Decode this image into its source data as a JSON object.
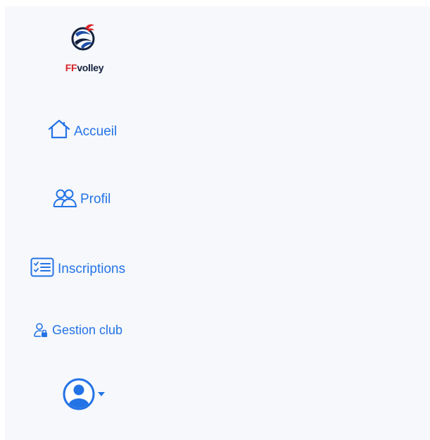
{
  "brand": {
    "prefix": "FF",
    "suffix": "volley",
    "colors": {
      "red": "#d8232a",
      "navy": "#14213d",
      "blue": "#1f4fa8"
    }
  },
  "nav": {
    "items": [
      {
        "id": "accueil",
        "label": "Accueil",
        "icon": "home-icon"
      },
      {
        "id": "profil",
        "label": "Profil",
        "icon": "users-icon"
      },
      {
        "id": "inscriptions",
        "label": "Inscriptions",
        "icon": "checklist-icon"
      },
      {
        "id": "gestion",
        "label": "Gestion club",
        "icon": "user-lock-icon"
      }
    ]
  },
  "user_menu": {
    "icon": "user-circle-icon",
    "indicator": "caret-down-icon"
  },
  "theme": {
    "accent": "#2473e6",
    "panel_bg": "#f6f8fb"
  }
}
